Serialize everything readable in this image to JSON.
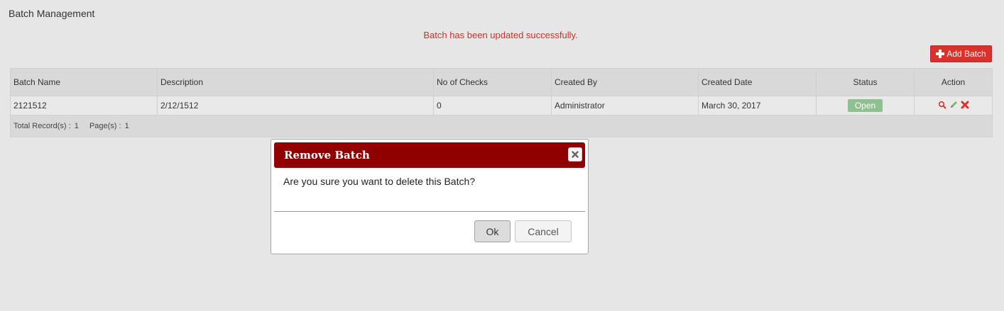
{
  "page": {
    "title": "Batch Management"
  },
  "message": {
    "success": "Batch has been updated successfully."
  },
  "toolbar": {
    "add_label": "Add Batch"
  },
  "table": {
    "columns": [
      "Batch Name",
      "Description",
      "No of Checks",
      "Created By",
      "Created Date",
      "Status",
      "Action"
    ],
    "rows": [
      {
        "batch_name": "2121512",
        "description": "2/12/1512",
        "checks": "0",
        "created_by": "Administrator",
        "created_date": "March 30, 2017",
        "status": "Open"
      }
    ],
    "footer": {
      "records_label": "Total Record(s) :",
      "records": "1",
      "pages_label": "Page(s) :",
      "pages": "1"
    }
  },
  "dialog": {
    "title": "Remove Batch",
    "message": "Are you sure you want to delete this Batch?",
    "ok_label": "Ok",
    "cancel_label": "Cancel"
  },
  "icons": {
    "add": "plus-icon",
    "view": "search-icon",
    "edit": "pencil-icon",
    "delete": "delete-icon",
    "close": "close-icon"
  },
  "colors": {
    "accent": "#d9322d",
    "dialog_header": "#900000",
    "status_open": "#8fc08f",
    "message": "#c9302c"
  }
}
